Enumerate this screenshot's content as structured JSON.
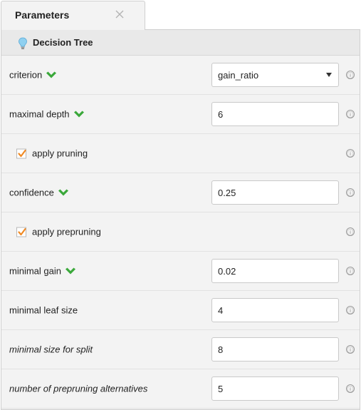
{
  "tab": {
    "title": "Parameters",
    "close": "✕"
  },
  "operator": {
    "title": "Decision Tree"
  },
  "info_glyph": "ⓘ",
  "params": {
    "criterion": {
      "label": "criterion",
      "value": "gain_ratio"
    },
    "maximal_depth": {
      "label": "maximal depth",
      "value": "6"
    },
    "apply_pruning": {
      "label": "apply pruning",
      "checked": true
    },
    "confidence": {
      "label": "confidence",
      "value": "0.25"
    },
    "apply_prepruning": {
      "label": "apply prepruning",
      "checked": true
    },
    "minimal_gain": {
      "label": "minimal gain",
      "value": "0.02"
    },
    "minimal_leaf_size": {
      "label": "minimal leaf size",
      "value": "4"
    },
    "minimal_size_for_split": {
      "label": "minimal size for split",
      "value": "8"
    },
    "number_of_prepruning_alternatives": {
      "label": "number of prepruning alternatives",
      "value": "5"
    }
  },
  "colors": {
    "chevron": "#3aa83a",
    "checkbox": "#f08a24",
    "panel_bg": "#f3f3f3",
    "header_bg": "#e9e9e9"
  }
}
